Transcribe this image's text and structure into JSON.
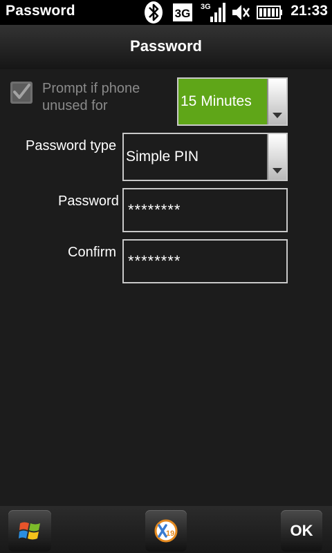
{
  "status_bar": {
    "app_title": "Password",
    "network_label": "3G",
    "signal_label": "3G",
    "time": "21:33",
    "icons": [
      "bluetooth-icon",
      "network-3g-icon",
      "signal-strength-icon",
      "volume-icon",
      "battery-icon"
    ]
  },
  "header": {
    "title": "Password"
  },
  "form": {
    "prompt_checkbox": {
      "label": "Prompt if phone unused for",
      "checked": true,
      "enabled": false
    },
    "timeout": {
      "value": "15 Minutes",
      "highlight_color": "#5fa618"
    },
    "password_type": {
      "label": "Password type",
      "value": "Simple PIN"
    },
    "password": {
      "label": "Password",
      "value": "********"
    },
    "confirm": {
      "label": "Confirm",
      "value": "********"
    }
  },
  "bottom_bar": {
    "start_icon": "windows-start-icon",
    "center_icon": "x19-app-icon",
    "ok_label": "OK"
  }
}
